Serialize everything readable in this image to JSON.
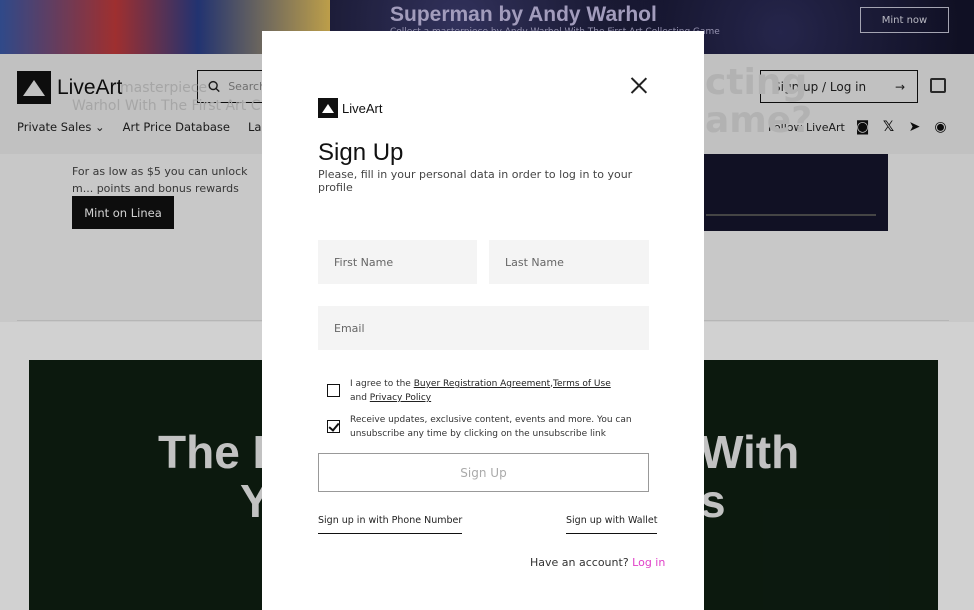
{
  "banner": {
    "title": "Superman by Andy Warhol",
    "subtitle": "Collect a masterpiece by Andy Warhol With The First Art Collecting Game",
    "cta": "Mint now"
  },
  "header": {
    "brand": "LiveArt",
    "search_placeholder": "Search",
    "nav": [
      "Private Sales",
      "Art Price Database",
      "Launchpad"
    ],
    "signin": "Sign up / Log in",
    "follow": "Follow LiveArt"
  },
  "hero": {
    "faded_line1": "masterpiece",
    "faded_line2": "Warhol With The First Art C",
    "body": "For as low as $5 you can unlock m... points and bonus rewards",
    "cta": "Mint on Linea",
    "faded_right1": "cting",
    "faded_right2": "ame?"
  },
  "promo": {
    "left1": "The I",
    "left2": "Y",
    "right1": "With",
    "right2": "s"
  },
  "modal": {
    "brand": "LiveArt",
    "title": "Sign Up",
    "subtitle": "Please, fill in your personal data in order to log in to your profile",
    "first_name_placeholder": "First Name",
    "last_name_placeholder": "Last Name",
    "email_placeholder": "Email",
    "agree_prefix": "I agree to the ",
    "agree_link1": "Buyer Registration Agreement",
    "agree_sep": ",",
    "agree_link2": "Terms of Use",
    "agree_and": " and ",
    "agree_link3": "Privacy Policy",
    "updates_text": "Receive updates, exclusive content, events and more. You can unsubscribe any time by clicking on the unsubscribe link",
    "agree_checked": false,
    "updates_checked": true,
    "submit": "Sign Up",
    "phone_link": "Sign up in with Phone Number",
    "wallet_link": "Sign up with Wallet",
    "have_account": "Have an account? ",
    "login_link": "Log in"
  },
  "colors": {
    "accent": "#e040c8",
    "promo_bg": "#0f1f12",
    "dark": "#111111"
  }
}
